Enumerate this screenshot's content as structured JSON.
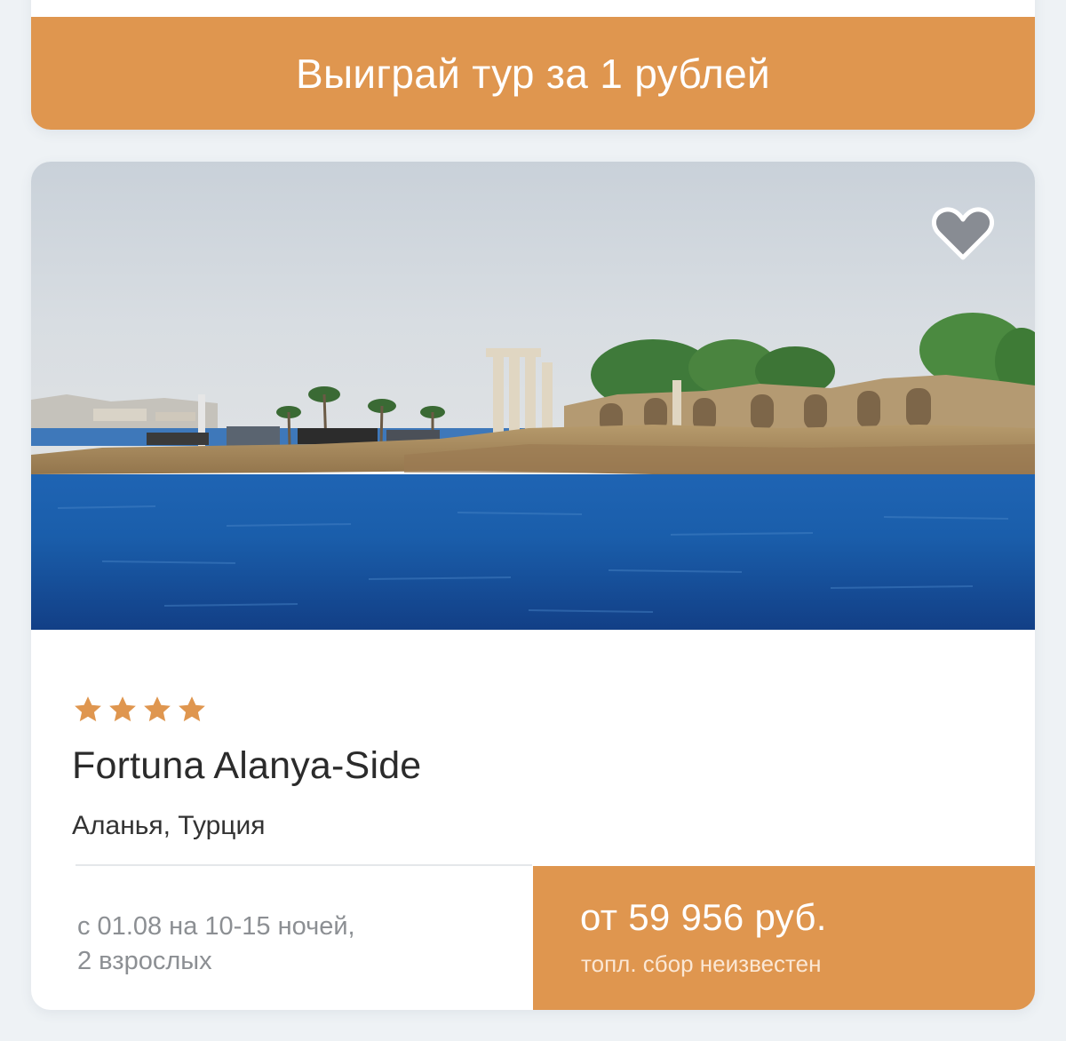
{
  "promo": {
    "button_label": "Выиграй тур за 1 рублей"
  },
  "hotel": {
    "rating_stars": 4,
    "name": "Fortuna Alanya-Side",
    "location": "Аланья, Турция",
    "dates_line1": "с 01.08 на 10-15 ночей,",
    "dates_line2": "2 взрослых",
    "price": "от 59 956 руб.",
    "fuel_note": "топл. сбор неизвестен",
    "favorite_icon": "heart-icon",
    "photo": "seaside-ruins-photo"
  },
  "colors": {
    "accent": "#df964f",
    "background": "#eef2f5",
    "card": "#ffffff",
    "text_dark": "#2b2b2b",
    "text_muted": "#8c8f93"
  }
}
